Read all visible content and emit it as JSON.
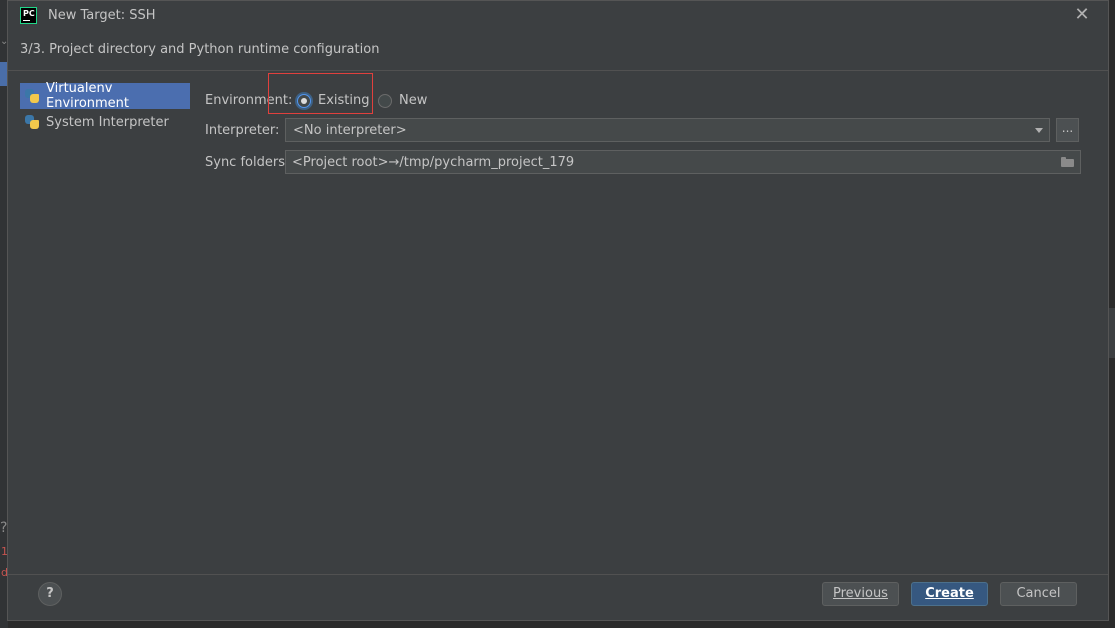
{
  "dialog": {
    "app_logo_text": "PC",
    "title": "New Target: SSH",
    "close_glyph": "✕",
    "subtitle": "3/3. Project directory and Python runtime configuration"
  },
  "sidebar": {
    "items": [
      {
        "label": "Virtualenv Environment",
        "icon": "python-icon",
        "selected": true
      },
      {
        "label": "System Interpreter",
        "icon": "python-icon",
        "selected": false
      }
    ]
  },
  "form": {
    "environment_label": "Environment:",
    "environment_options": [
      {
        "label": "Existing",
        "checked": true
      },
      {
        "label": "New",
        "checked": false
      }
    ],
    "interpreter_label": "Interpreter:",
    "interpreter_value": "<No interpreter>",
    "interpreter_browse_label": "...",
    "sync_label": "Sync folders:",
    "sync_value": "<Project root>→/tmp/pycharm_project_179"
  },
  "footer": {
    "help_label": "?",
    "previous_label": "Previous",
    "create_label": "Create",
    "cancel_label": "Cancel"
  },
  "background": {
    "chevron": "⌄",
    "question": "?",
    "red_glyph_1": "1",
    "red_glyph_2": "d"
  },
  "colors": {
    "selection": "#4b6eaf",
    "primary_button": "#365880",
    "highlight_box": "#e0403d",
    "dialog_bg": "#3c3f41"
  }
}
